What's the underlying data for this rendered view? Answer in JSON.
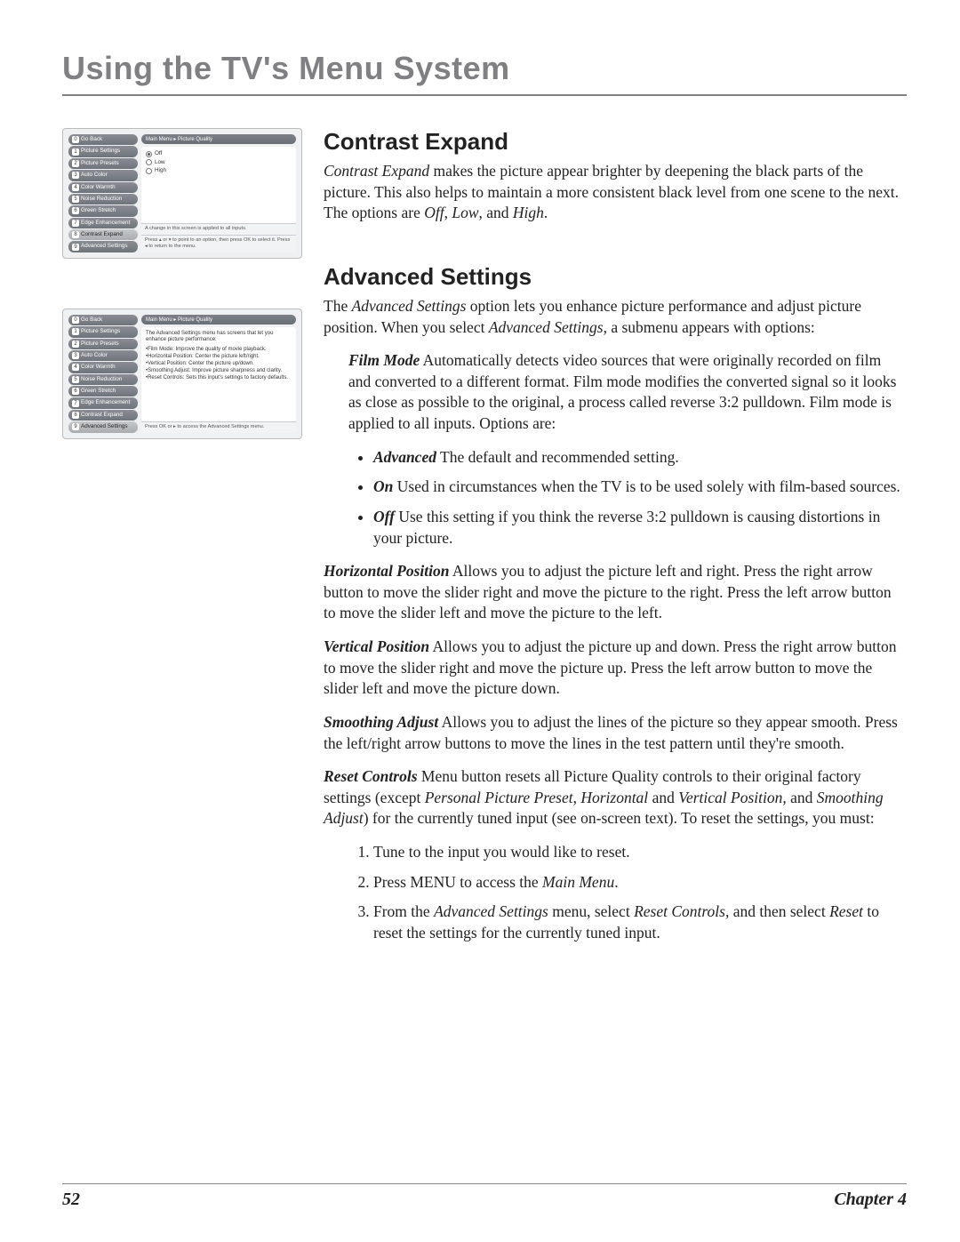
{
  "page_title": "Using the TV's Menu System",
  "footer": {
    "page": "52",
    "chapter": "Chapter 4"
  },
  "shot1": {
    "crumb": "Main Menu ▸ Picture Quality",
    "sidebar": [
      {
        "num": "0",
        "label": "Go Back"
      },
      {
        "num": "1",
        "label": "Picture Settings"
      },
      {
        "num": "2",
        "label": "Picture Presets"
      },
      {
        "num": "3",
        "label": "Auto Color"
      },
      {
        "num": "4",
        "label": "Color Warmth"
      },
      {
        "num": "5",
        "label": "Noise Reduction"
      },
      {
        "num": "6",
        "label": "Green Stretch"
      },
      {
        "num": "7",
        "label": "Edge Enhancement"
      },
      {
        "num": "8",
        "label": "Contrast Expand"
      },
      {
        "num": "9",
        "label": "Advanced Settings"
      }
    ],
    "selected": 8,
    "options": [
      "Off",
      "Low",
      "High"
    ],
    "help1": "A change in this screen is applied to all inputs.",
    "help2": "Press ▴ or ▾ to point to an option, then press OK to select it. Press ◂ to return to the menu."
  },
  "shot2": {
    "crumb": "Main Menu ▸ Picture Quality",
    "sidebar_selected": 9,
    "desc_intro": "The Advanced Settings menu has screens that let you enhance picture performance:",
    "desc_items": [
      "•Film Mode: Improve the quality of movie playback.",
      "•Horizontal Position: Center the picture left/right.",
      "•Vertical Position: Center the picture up/down.",
      "•Smoothing Adjust: Improve picture sharpness and clarity.",
      "•Reset Controls: Sets this input's settings to factory defaults."
    ],
    "help": "Press OK or ▸ to access the Advanced Settings menu."
  },
  "s1": {
    "heading": "Contrast Expand",
    "para_lead": "Contrast Expand",
    "para_rest": " makes the picture appear brighter by deepening the black parts of the picture. This also helps to maintain a more consistent black level from one scene to the next. The options are ",
    "opt1": "Off",
    "sep1": ", ",
    "opt2": "Low",
    "sep2": ", and ",
    "opt3": "High",
    "tail": "."
  },
  "s2": {
    "heading": "Advanced Settings",
    "intro_a": "The ",
    "intro_b": "Advanced Settings",
    "intro_c": " option lets you enhance picture performance and adjust picture position. When you select ",
    "intro_d": "Advanced Settings",
    "intro_e": ", a submenu appears with options:",
    "film_label": "Film Mode",
    "film_text": "   Automatically detects video sources that were originally recorded on film and converted to a different format. Film mode modifies the converted signal so it looks as close as possible to the original, a process called reverse 3:2 pulldown. Film mode is applied to all inputs. Options are:",
    "film_opts": [
      {
        "name": "Advanced",
        "text": "   The default and recommended setting."
      },
      {
        "name": "On",
        "text": "   Used in circumstances when the TV is to be used solely with film-based sources."
      },
      {
        "name": "Off",
        "text": "   Use this setting if you think the reverse 3:2 pulldown is causing distortions in your picture."
      }
    ],
    "hpos_label": "Horizontal Position",
    "hpos_text": "   Allows you to adjust the picture left and right. Press the right arrow button to move the slider right and move the picture to the right. Press the left arrow button to move the slider left and move the picture to the left.",
    "vpos_label": "Vertical Position",
    "vpos_text": "   Allows you to adjust the picture up and down. Press the right arrow button to move the slider right and move the picture up. Press the left arrow button to move the slider left and move the picture down.",
    "smooth_label": "Smoothing Adjust",
    "smooth_text": "   Allows you to adjust the lines of the picture so they appear smooth. Press the left/right arrow buttons to move the lines in the test pattern until they're smooth.",
    "reset_label": "Reset Controls",
    "reset_a": "   Menu button resets all Picture Quality controls to their original factory settings (except ",
    "reset_b": "Personal Picture Preset",
    "reset_c": ", ",
    "reset_d": "Horizontal",
    "reset_e": " and ",
    "reset_f": "Vertical Position,",
    "reset_g": " and ",
    "reset_h": "Smoothing Adjust",
    "reset_i": ") for the currently tuned input (see on-screen text). To reset the settings, you must:",
    "steps": {
      "s1": "Tune to the input you would like to reset.",
      "s2a": "Press MENU to access the ",
      "s2b": "Main Menu",
      "s2c": ".",
      "s3a": "From the ",
      "s3b": "Advanced Settings",
      "s3c": " menu, select ",
      "s3d": "Reset Controls,",
      "s3e": " and then select ",
      "s3f": "Reset",
      "s3g": " to reset the settings for the currently tuned input."
    }
  }
}
